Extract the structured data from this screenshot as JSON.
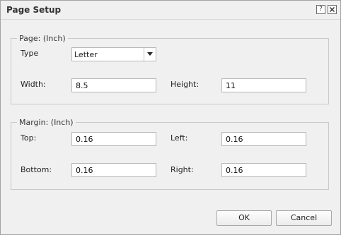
{
  "window": {
    "title": "Page Setup"
  },
  "titlebar_buttons": {
    "help_icon": "?",
    "close_icon": "close"
  },
  "page_group": {
    "legend": "Page: (Inch)",
    "type_label": "Type",
    "type_value": "Letter",
    "width_label": "Width:",
    "width_value": "8.5",
    "height_label": "Height:",
    "height_value": "11"
  },
  "margin_group": {
    "legend": "Margin: (Inch)",
    "top_label": "Top:",
    "top_value": "0.16",
    "left_label": "Left:",
    "left_value": "0.16",
    "bottom_label": "Bottom:",
    "bottom_value": "0.16",
    "right_label": "Right:",
    "right_value": "0.16"
  },
  "buttons": {
    "ok_label": "OK",
    "cancel_label": "Cancel"
  }
}
